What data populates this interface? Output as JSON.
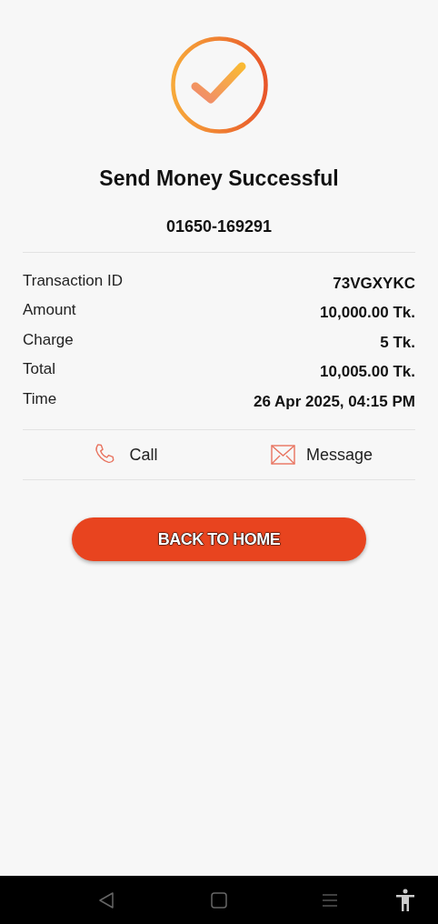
{
  "title": "Send Money Successful",
  "recipient": "01650-169291",
  "details": [
    {
      "label": "Transaction ID",
      "value": "73VGXYKC"
    },
    {
      "label": "Amount",
      "value": "10,000.00 Tk."
    },
    {
      "label": "Charge",
      "value": "5 Tk."
    },
    {
      "label": "Total",
      "value": "10,005.00 Tk."
    },
    {
      "label": "Time",
      "value": "26 Apr 2025, 04:15 PM"
    }
  ],
  "actions": [
    {
      "kind": "call",
      "label": "Call"
    },
    {
      "kind": "message",
      "label": "Message"
    }
  ],
  "button": "BACK TO HOME"
}
